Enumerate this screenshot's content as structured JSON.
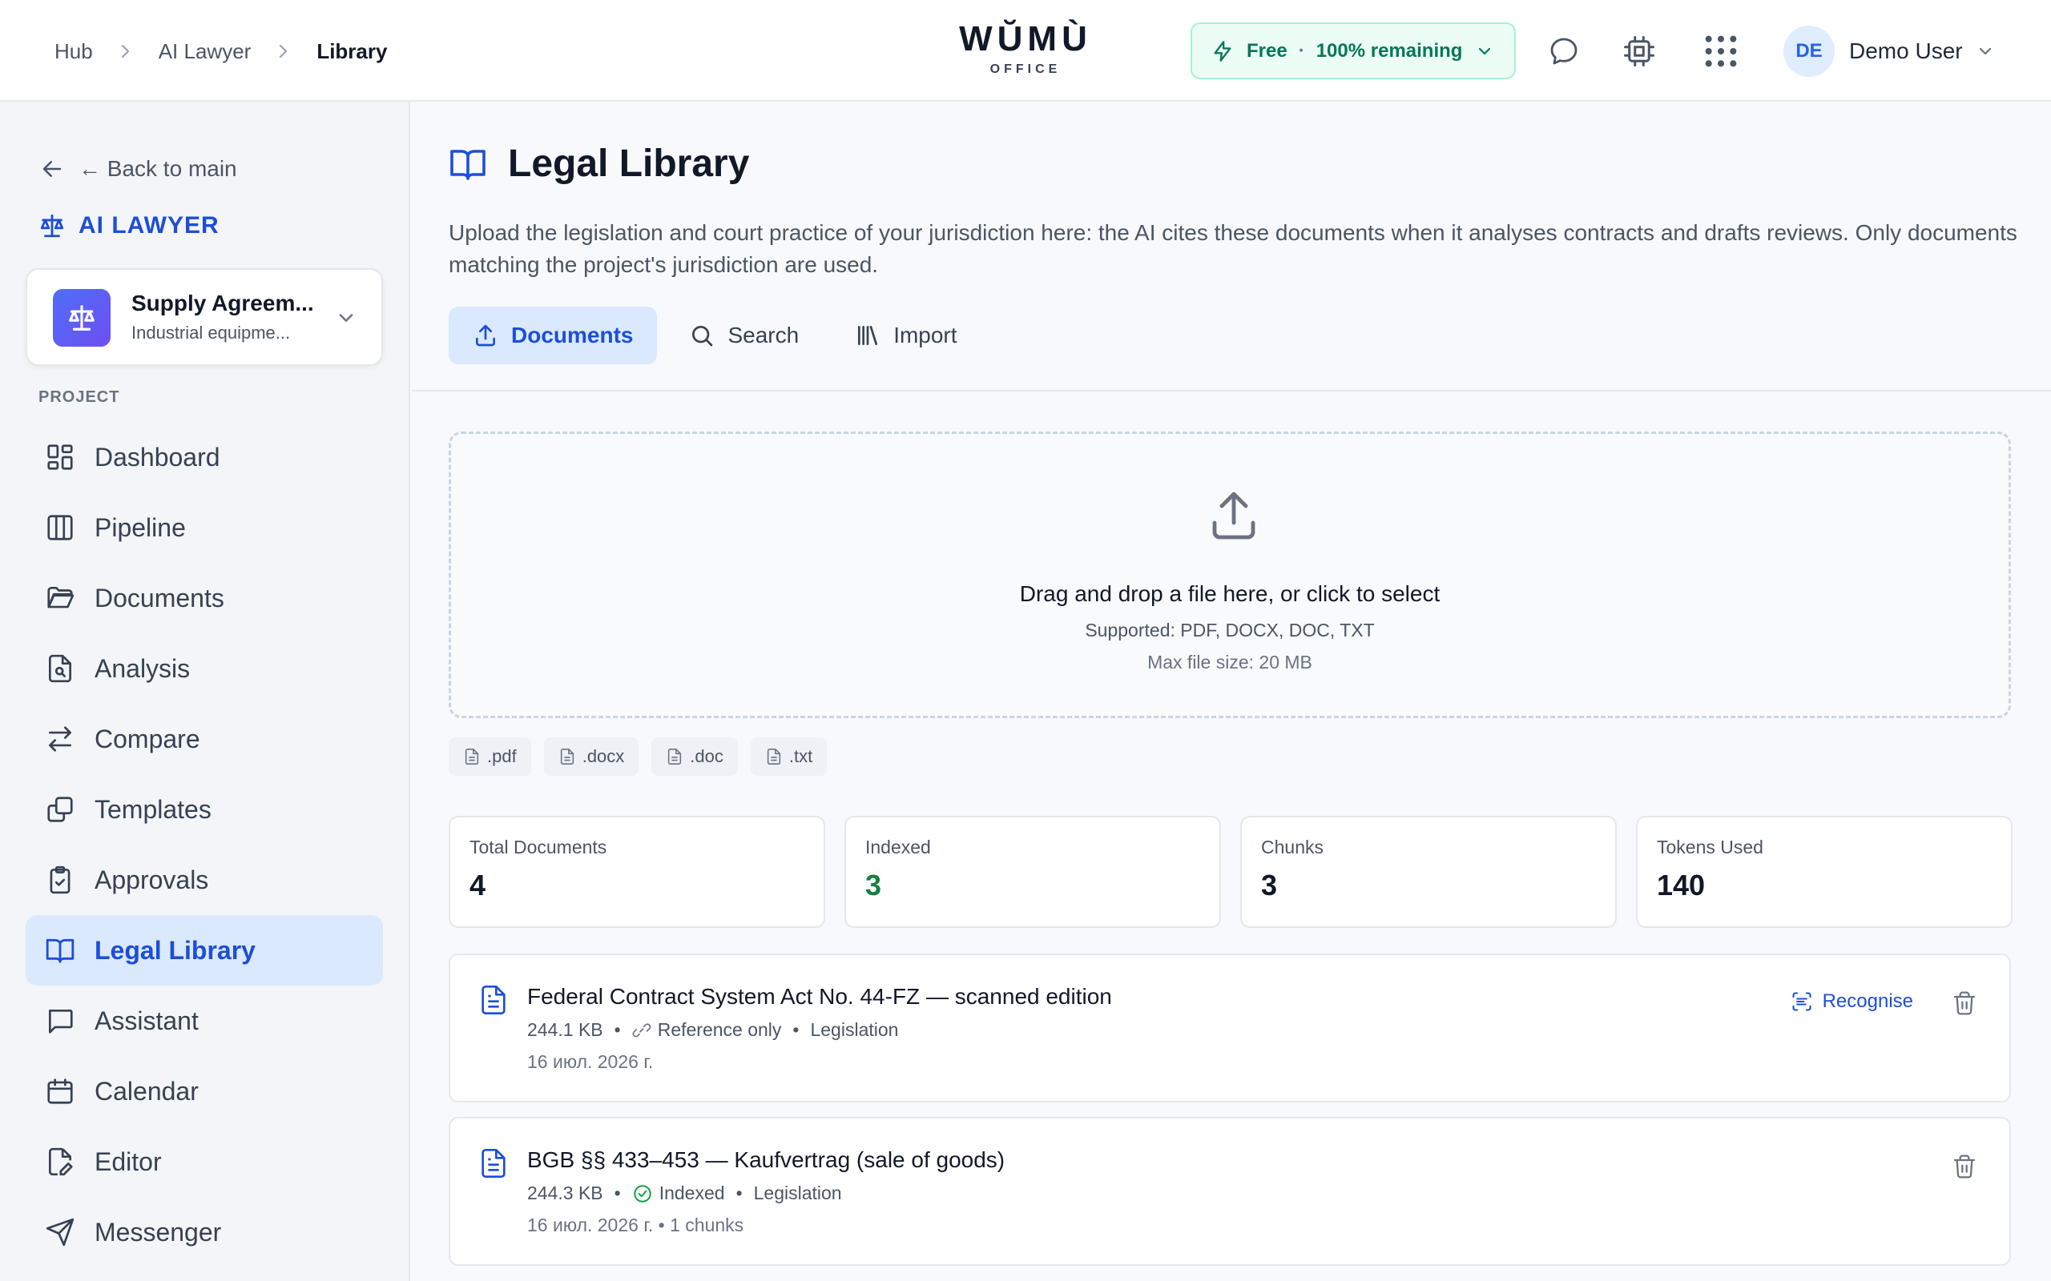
{
  "breadcrumb": {
    "items": [
      "Hub",
      "AI Lawyer"
    ],
    "current": "Library"
  },
  "logo": {
    "word": "WŬMÙ",
    "sub": "OFFICE"
  },
  "plan": {
    "tier": "Free",
    "remaining": "100% remaining"
  },
  "user": {
    "initials": "DE",
    "name": "Demo User"
  },
  "sidebar": {
    "back_label": "← Back to main",
    "section_title": "AI LAWYER",
    "project": {
      "name": "Supply Agreem...",
      "subtitle": "Industrial equipme..."
    },
    "group_label": "PROJECT",
    "items": [
      {
        "label": "Dashboard",
        "icon": "dashboard-icon"
      },
      {
        "label": "Pipeline",
        "icon": "pipeline-icon"
      },
      {
        "label": "Documents",
        "icon": "folder-icon"
      },
      {
        "label": "Analysis",
        "icon": "file-search-icon"
      },
      {
        "label": "Compare",
        "icon": "compare-icon"
      },
      {
        "label": "Templates",
        "icon": "templates-icon"
      },
      {
        "label": "Approvals",
        "icon": "clipboard-check-icon"
      },
      {
        "label": "Legal Library",
        "icon": "book-icon",
        "active": true
      },
      {
        "label": "Assistant",
        "icon": "chat-icon"
      },
      {
        "label": "Calendar",
        "icon": "calendar-icon"
      },
      {
        "label": "Editor",
        "icon": "edit-file-icon"
      },
      {
        "label": "Messenger",
        "icon": "send-icon"
      }
    ]
  },
  "page": {
    "title": "Legal Library",
    "description": "Upload the legislation and court practice of your jurisdiction here: the AI cites these documents when it analyses contracts and drafts reviews. Only documents matching the project's jurisdiction are used.",
    "tabs": [
      {
        "label": "Documents",
        "active": true
      },
      {
        "label": "Search"
      },
      {
        "label": "Import"
      }
    ]
  },
  "dropzone": {
    "title": "Drag and drop a file here, or click to select",
    "supported": "Supported: PDF, DOCX, DOC, TXT",
    "max_size": "Max file size: 20 MB"
  },
  "extensions": [
    ".pdf",
    ".docx",
    ".doc",
    ".txt"
  ],
  "stats": [
    {
      "label": "Total Documents",
      "value": "4"
    },
    {
      "label": "Indexed",
      "value": "3"
    },
    {
      "label": "Chunks",
      "value": "3"
    },
    {
      "label": "Tokens Used",
      "value": "140"
    }
  ],
  "documents": [
    {
      "title": "Federal Contract System Act No. 44-FZ — scanned edition",
      "size": "244.1 KB",
      "status": "Reference only",
      "category": "Legislation",
      "date": "16 июл. 2026 г.",
      "action": "Recognise"
    },
    {
      "title": "BGB §§ 433–453 — Kaufvertrag (sale of goods)",
      "size": "244.3 KB",
      "status": "Indexed",
      "category": "Legislation",
      "date": "16 июл. 2026 г. • 1 chunks"
    }
  ],
  "colors": {
    "accent": "#1d4ed8",
    "active_bg": "#dbe9fe",
    "success": "#15803d",
    "plan_bg": "#ecfdf5"
  }
}
